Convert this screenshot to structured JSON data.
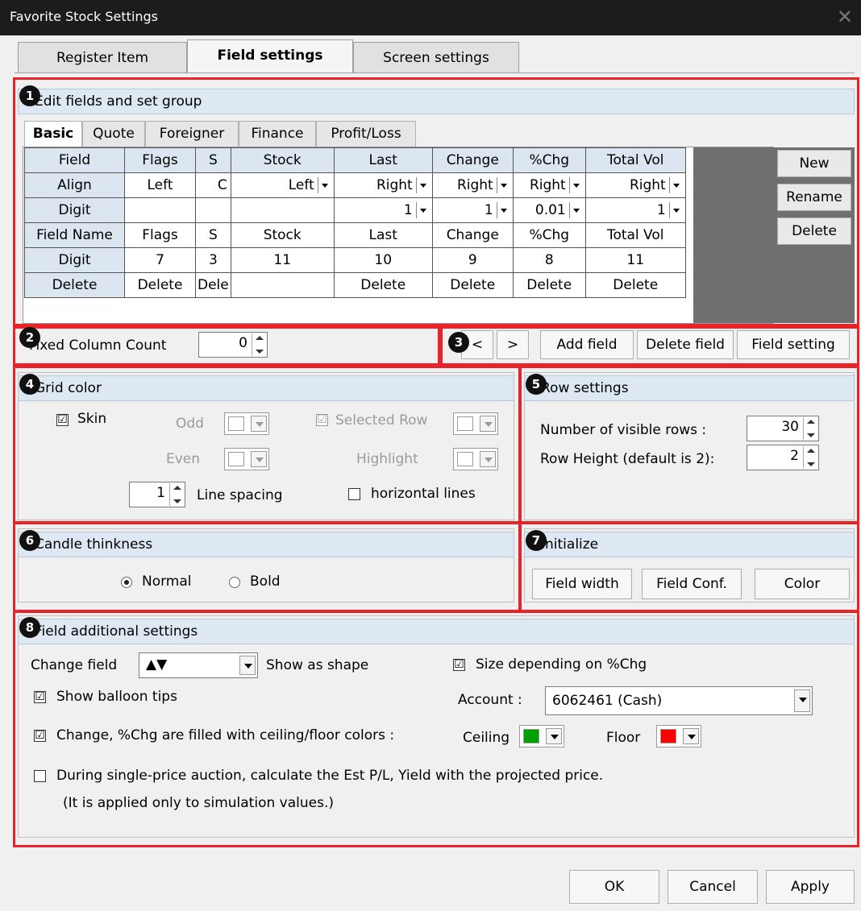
{
  "window": {
    "title": "Favorite Stock Settings",
    "close_glyph": "✕"
  },
  "tabs": [
    {
      "label": "Register Item"
    },
    {
      "label": "Field settings"
    },
    {
      "label": "Screen settings"
    }
  ],
  "badges": [
    "1",
    "2",
    "3",
    "4",
    "5",
    "6",
    "7",
    "8"
  ],
  "edit_fields": {
    "header": "Edit fields and set group",
    "inner_tabs": [
      "Basic",
      "Quote",
      "Foreigner",
      "Finance",
      "Profit/Loss"
    ],
    "grid": {
      "rows": [
        [
          "Field",
          "Flags",
          "S",
          "Stock",
          "Last",
          "Change",
          "%Chg",
          "Total Vol"
        ],
        [
          "Align",
          "Left",
          "C",
          "Left",
          "Right",
          "Right",
          "Right",
          "Right"
        ],
        [
          "Digit",
          "",
          "",
          "",
          "1",
          "1",
          "0.01",
          "1"
        ],
        [
          "Field Name",
          "Flags",
          "S",
          "Stock",
          "Last",
          "Change",
          "%Chg",
          "Total Vol"
        ],
        [
          "Digit",
          "7",
          "3",
          "11",
          "10",
          "9",
          "8",
          "11"
        ],
        [
          "Delete",
          "Delete",
          "Dele",
          "",
          "Delete",
          "Delete",
          "Delete",
          "Delete"
        ]
      ]
    },
    "buttons": {
      "new": "New",
      "rename": "Rename",
      "delete": "Delete"
    }
  },
  "fixed_column": {
    "label": "Fixed Column Count",
    "value": "0"
  },
  "field_nav": {
    "prev": "<",
    "next": ">",
    "add": "Add field",
    "delete": "Delete field",
    "setting": "Field setting"
  },
  "grid_color": {
    "header": "Grid color",
    "skin_label": "Skin",
    "skin_checked": "☑",
    "odd": "Odd",
    "even": "Even",
    "selected_row": "Selected Row",
    "highlight": "Highlight",
    "line_spacing_value": "1",
    "line_spacing_label": "Line spacing",
    "horizontal_lines": "horizontal lines"
  },
  "row_settings": {
    "header": "Row settings",
    "visible_rows_label": "Number of visible rows  :",
    "visible_rows_value": "30",
    "row_height_label": "Row Height (default is 2):",
    "row_height_value": "2"
  },
  "candle": {
    "header": "Candle thinkness",
    "normal": "Normal",
    "bold": "Bold",
    "selected": "Normal"
  },
  "initialize": {
    "header": "Initialize",
    "field_width": "Field width",
    "field_conf": "Field Conf.",
    "color": "Color"
  },
  "additional": {
    "header": "Field additional settings",
    "change_field_label": "Change field",
    "change_field_value": "▲▼",
    "show_as_shape": "Show as shape",
    "size_depending": "Size depending on %Chg",
    "balloon_tips": "Show balloon tips",
    "account_label": "Account :",
    "account_value": "6062461 (Cash)",
    "ceiling_floor_label": "Change, %Chg are filled with ceiling/floor colors :",
    "ceiling_label": "Ceiling",
    "floor_label": "Floor",
    "ceiling_color": "#00a000",
    "floor_color": "#ff0000",
    "auction_label": "During single-price auction, calculate the Est P/L, Yield with the projected price.",
    "auction_note": "(It is applied only to simulation values.)"
  },
  "footer": {
    "ok": "OK",
    "cancel": "Cancel",
    "apply": "Apply"
  }
}
